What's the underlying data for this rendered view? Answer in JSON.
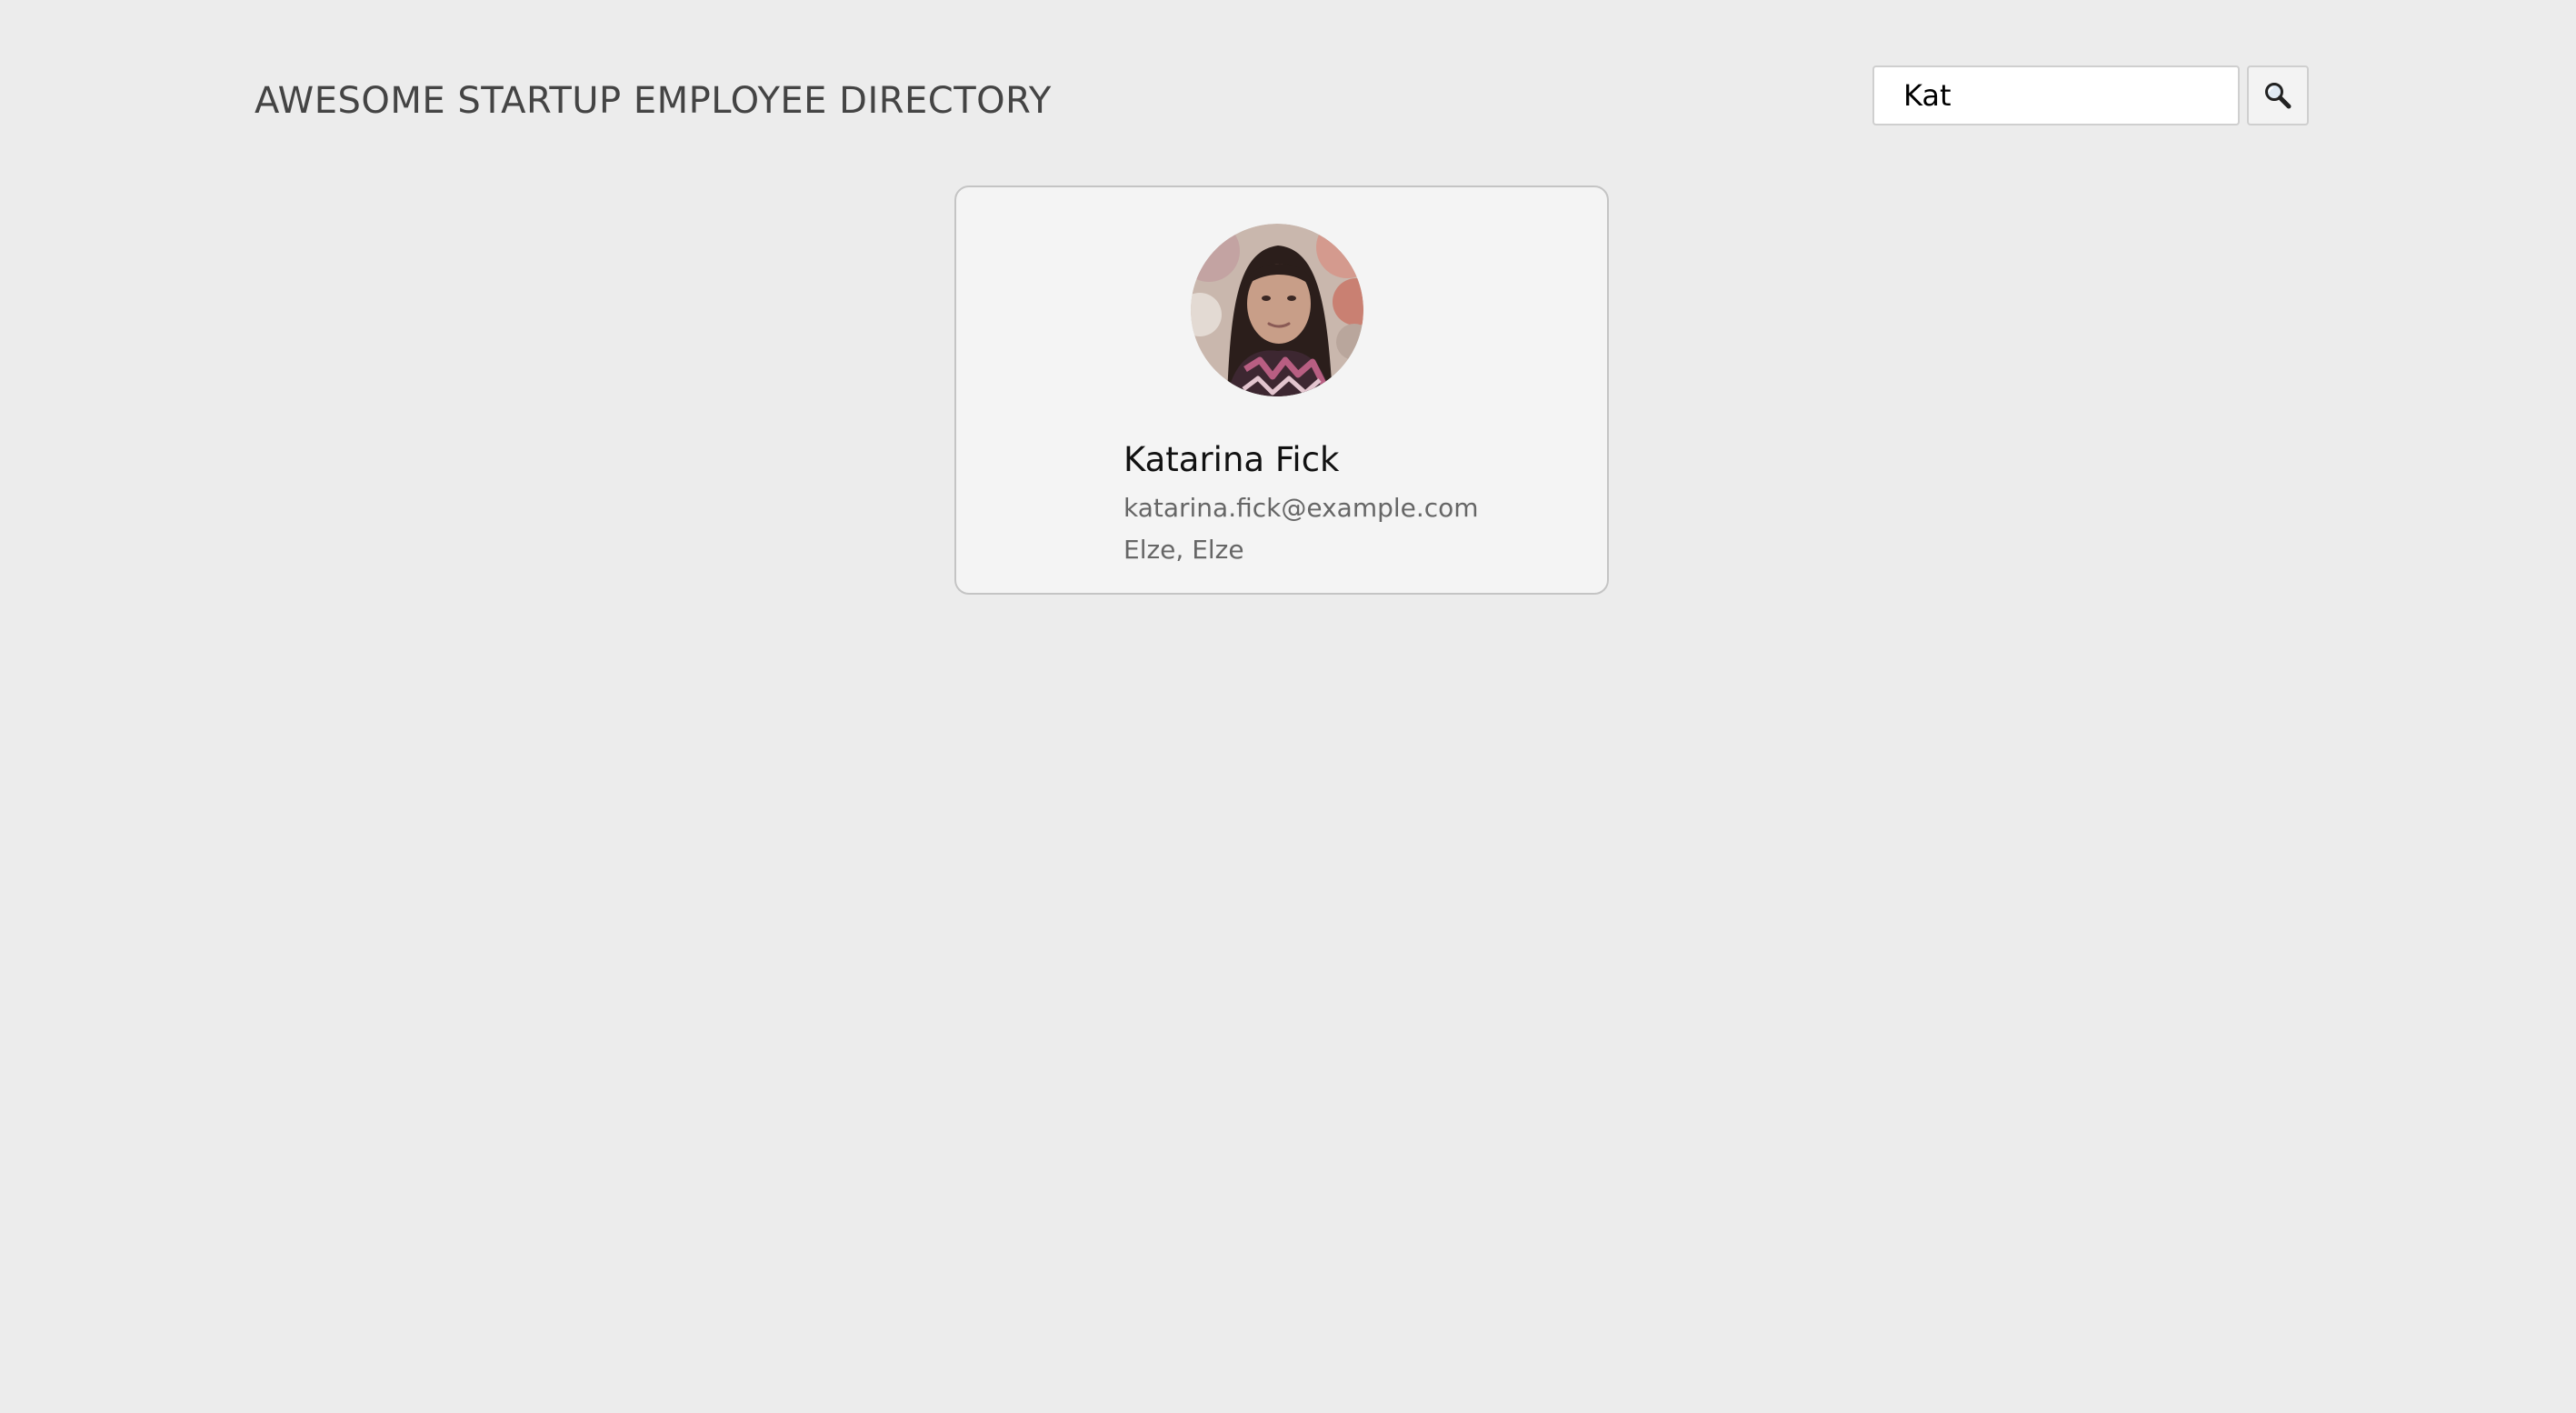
{
  "header": {
    "title": "AWESOME STARTUP EMPLOYEE DIRECTORY"
  },
  "search": {
    "value": "Kat",
    "button_icon": "search-icon"
  },
  "results": [
    {
      "avatar": "employee-photo",
      "name": "Katarina Fick",
      "email": "katarina.fick@example.com",
      "location": "Elze, Elze"
    }
  ],
  "colors": {
    "background": "#ececec",
    "card_background": "#f4f4f4",
    "card_border": "#c4c4c4"
  }
}
